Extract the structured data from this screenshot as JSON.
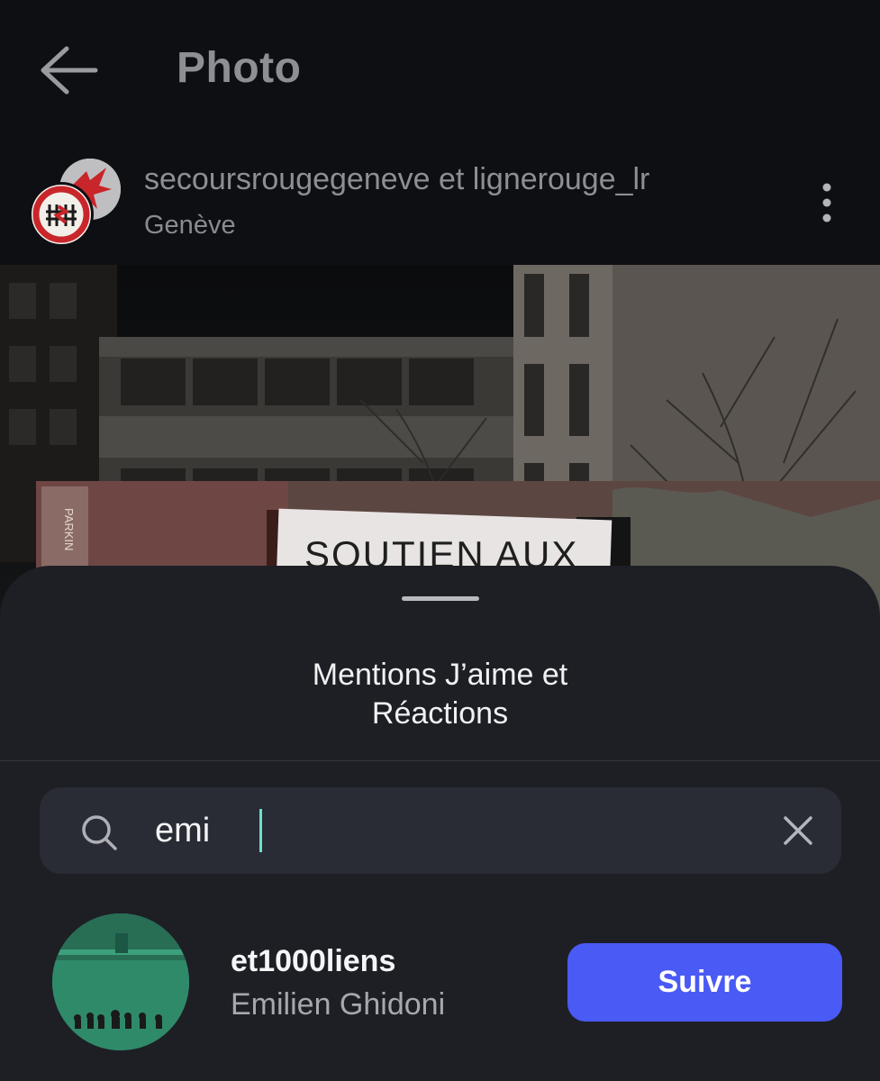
{
  "header": {
    "title": "Photo",
    "back_icon": "arrow-left-icon"
  },
  "post": {
    "authors": "secoursrougegeneve et lignerouge_lr",
    "location": "Genève",
    "banner_text": "SOUTIEN AUX",
    "sign_text": "PARKIN",
    "more_icon": "more-vertical-icon"
  },
  "sheet": {
    "title_line1": "Mentions J’aime et",
    "title_line2": "Réactions"
  },
  "search": {
    "value": "emi",
    "search_icon": "search-icon",
    "clear_icon": "close-icon"
  },
  "results": [
    {
      "username": "et1000liens",
      "full_name": "Emilien Ghidoni",
      "follow_label": "Suivre"
    }
  ],
  "colors": {
    "accent": "#4a5af5",
    "caret": "#6be0c9",
    "sheet_bg": "#1e1f25",
    "search_bg": "#292c34"
  }
}
